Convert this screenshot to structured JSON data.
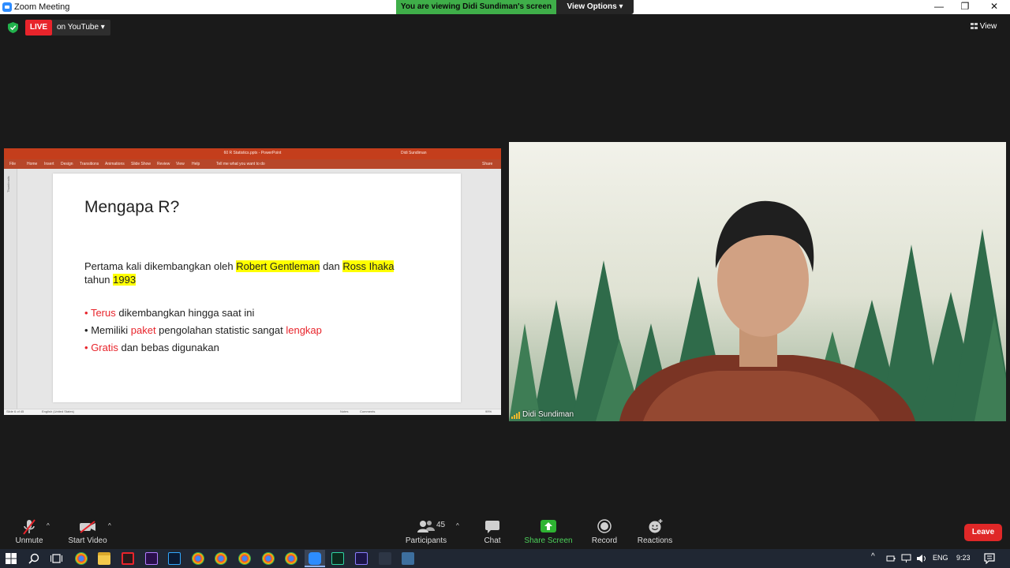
{
  "window": {
    "title": "Zoom Meeting",
    "minimize": "—",
    "maximize": "❐",
    "close": "✕"
  },
  "banner": {
    "viewing": "You are viewing Didi Sundiman's screen",
    "view_options": "View Options ▾"
  },
  "live": {
    "badge": "LIVE",
    "destination": "on YouTube ▾"
  },
  "view_button": "View",
  "ppt": {
    "doc_title": "60 R Statistics.pptx - PowerPoint",
    "user": "Didi Sundiman",
    "ribbon_tabs": [
      "File",
      "Home",
      "Insert",
      "Design",
      "Transitions",
      "Animations",
      "Slide Show",
      "Review",
      "View",
      "Help",
      "Tell me what you want to do"
    ],
    "share": "Share",
    "thumbnails_label": "Thumbnails",
    "status_left": "Slide 6 of 45",
    "status_lang": "English (United States)",
    "status_notes": "Notes",
    "status_comments": "Comments",
    "zoom": "99%"
  },
  "slide": {
    "title": "Mengapa R?",
    "line1_a": "Pertama kali dikembangkan oleh ",
    "line1_hl1": "Robert Gentleman",
    "line1_b": " dan ",
    "line1_hl2": "Ross Ihaka",
    "line2_a": "tahun ",
    "line2_hl": "1993",
    "b1_red": "Terus",
    "b1_rest": " dikembangkan hingga saat ini",
    "b2_a": "Memiliki ",
    "b2_red1": "paket",
    "b2_b": " pengolahan statistic sangat ",
    "b2_red2": "lengkap",
    "b3_red": "Gratis",
    "b3_rest": " dan bebas digunakan",
    "bullet_char": "•"
  },
  "video": {
    "name": "Didi Sundiman"
  },
  "toolbar": {
    "unmute": "Unmute",
    "start_video": "Start Video",
    "participants": "Participants",
    "participant_count": "45",
    "chat": "Chat",
    "share_screen": "Share Screen",
    "record": "Record",
    "reactions": "Reactions",
    "leave": "Leave"
  },
  "tray": {
    "lang": "ENG",
    "time": "9:23"
  },
  "colors": {
    "live": "#e8242b",
    "banner": "#3fae49",
    "share_green": "#2eb432",
    "leave": "#e02828",
    "ppt": "#c43e1c"
  }
}
